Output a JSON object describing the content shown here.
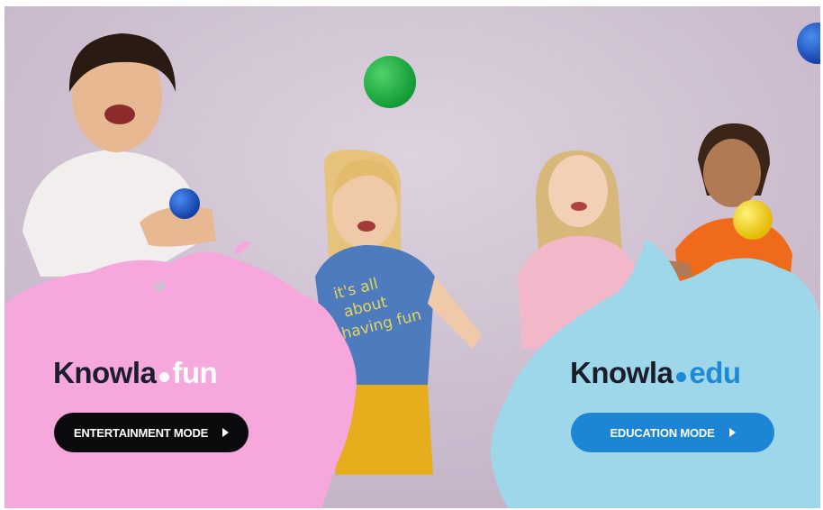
{
  "entertainment": {
    "brand_name": "Knowla",
    "brand_suffix": "fun",
    "button_label": "ENTERTAINMENT MODE",
    "panel_color": "#f6a8dc",
    "button_color": "#0b0b0e"
  },
  "education": {
    "brand_name": "Knowla",
    "brand_suffix": "edu",
    "button_label": "EDUCATION MODE",
    "panel_color": "#9ed7ea",
    "button_color": "#1d86d4"
  },
  "shirt_text": [
    "it's all",
    "about",
    "having fun"
  ],
  "icons": {
    "play": "play-triangle-icon",
    "logo_dot": "brand-dot-icon"
  }
}
